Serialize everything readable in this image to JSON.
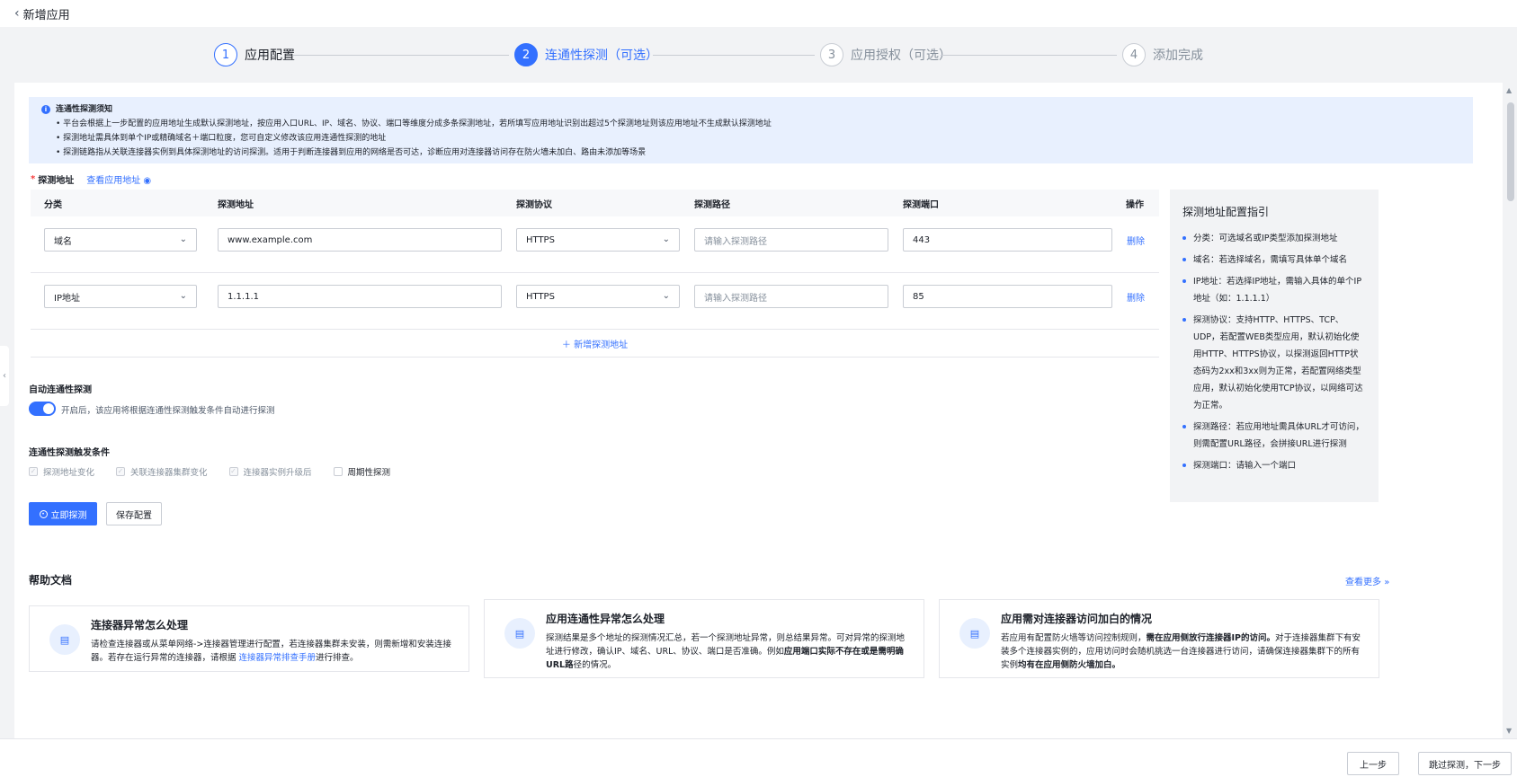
{
  "header": {
    "back_label": "新增应用"
  },
  "steps": [
    {
      "num": "1",
      "label": "应用配置"
    },
    {
      "num": "2",
      "label": "连通性探测（可选）"
    },
    {
      "num": "3",
      "label": "应用授权（可选）"
    },
    {
      "num": "4",
      "label": "添加完成"
    }
  ],
  "notice": {
    "title": "连通性探测须知",
    "items": [
      "平台会根据上一步配置的应用地址生成默认探测地址，按应用入口URL、IP、域名、协议、端口等维度分成多条探测地址，若所填写应用地址识别出超过5个探测地址则该应用地址不生成默认探测地址",
      "探测地址需具体到单个IP或精确域名＋端口粒度，您可自定义修改该应用连通性探测的地址",
      "探测链路指从关联连接器实例到具体探测地址的访问探测。适用于判断连接器到应用的网络是否可达，诊断应用对连接器访问存在防火墙未加白、路由未添加等场景"
    ]
  },
  "probe": {
    "label": "探测地址",
    "view_link": "查看应用地址",
    "columns": [
      "分类",
      "探测地址",
      "探测协议",
      "探测路径",
      "探测端口",
      "操作"
    ],
    "rows": [
      {
        "category": "域名",
        "address": "www.example.com",
        "protocol": "HTTPS",
        "path_placeholder": "请输入探测路径",
        "port": "443",
        "action": "删除"
      },
      {
        "category": "IP地址",
        "address": "1.1.1.1",
        "protocol": "HTTPS",
        "path_placeholder": "请输入探测路径",
        "port": "85",
        "action": "删除"
      }
    ],
    "add_label": "新增探测地址"
  },
  "guide": {
    "title": "探测地址配置指引",
    "items": [
      "分类：可选域名或IP类型添加探测地址",
      "域名：若选择域名，需填写具体单个域名",
      "IP地址：若选择IP地址，需输入具体的单个IP地址（如：1.1.1.1）",
      "探测协议：支持HTTP、HTTPS、TCP、UDP，若配置WEB类型应用，默认初始化使用HTTP、HTTPS协议，以探测返回HTTP状态码为2xx和3xx则为正常，若配置网络类型应用，默认初始化使用TCP协议，以网络可达为正常。",
      "探测路径：若应用地址需具体URL才可访问，则需配置URL路径，会拼接URL进行探测",
      "探测端口：请输入一个端口"
    ]
  },
  "auto": {
    "title": "自动连通性探测",
    "desc": "开启后，该应用将根据连通性探测触发条件自动进行探测",
    "enabled": true
  },
  "trigger": {
    "title": "连通性探测触发条件",
    "options": [
      {
        "label": "探测地址变化",
        "checked": true,
        "disabled": true
      },
      {
        "label": "关联连接器集群变化",
        "checked": true,
        "disabled": true
      },
      {
        "label": "连接器实例升级后",
        "checked": true,
        "disabled": true
      },
      {
        "label": "周期性探测",
        "checked": false,
        "disabled": false
      }
    ]
  },
  "actions": {
    "probe_now": "立即探测",
    "save": "保存配置"
  },
  "help": {
    "title": "帮助文档",
    "more": "查看更多",
    "cards": [
      {
        "title": "连接器异常怎么处理",
        "desc_a": "请检查连接器或从菜单网络->连接器管理进行配置，若连接器集群未安装，则需新增和安装连接器。若存在运行异常的连接器，请根据 ",
        "link": "连接器异常排查手册",
        "desc_b": "进行排查。"
      },
      {
        "title": "应用连通性异常怎么处理",
        "desc_a": "探测结果是多个地址的探测情况汇总，若一个探测地址异常，则总结果异常。可对异常的探测地址进行修改，确认IP、域名、URL、协议、端口是否准确。例如",
        "bold": "应用端口实际不存在或是需明确URL路",
        "desc_b": "径的情况。"
      },
      {
        "title": "应用需对连接器访问加白的情况",
        "desc_a": "若应用有配置防火墙等访问控制规则，",
        "bold": "需在应用侧放行连接器IP的访问。",
        "desc_b": "对于连接器集群下有安装多个连接器实例的，应用访问时会随机挑选一台连接器进行访问，请确保连接器集群下的所有实例",
        "bold2": "均有在应用侧防火墙加白。"
      }
    ]
  },
  "footer": {
    "prev": "上一步",
    "skip_next": "跳过探测，下一步"
  },
  "colors": {
    "primary": "#3370ff",
    "notice_bg": "#e8f0fe",
    "danger": "#f53f3f"
  }
}
